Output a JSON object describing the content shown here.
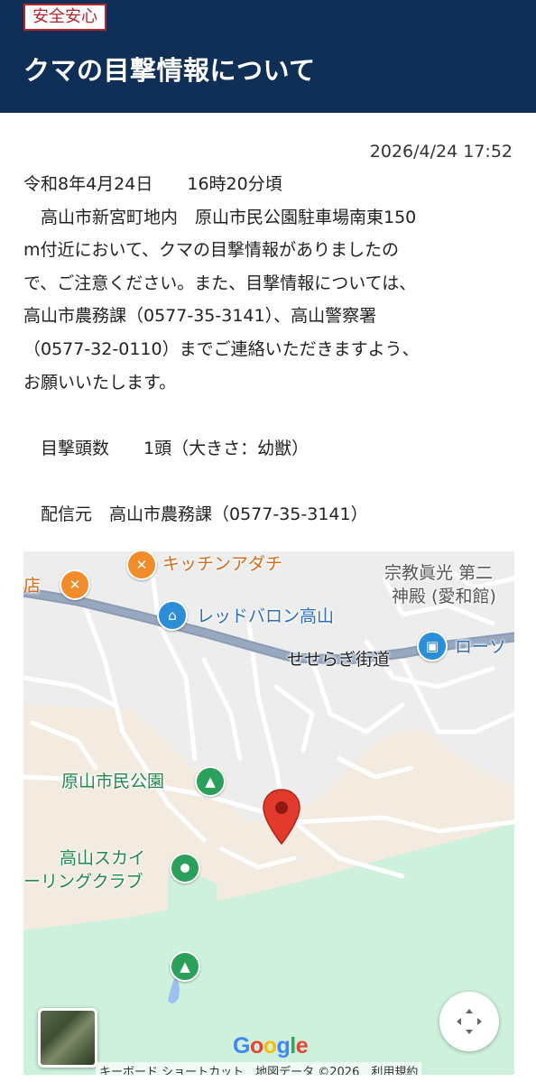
{
  "header": {
    "category": "安全安心",
    "title": "クマの目撃情報について"
  },
  "article": {
    "timestamp": "2026/4/24 17:52",
    "lines": [
      "令和8年4月24日　　16時20分頃",
      "　高山市新宮町地内　原山市民公園駐車場南東150",
      "m付近において、クマの目撃情報がありましたの",
      "で、ご注意ください。また、目撃情報については、",
      "高山市農務課（0577-35-3141）、高山警察署",
      "（0577-32-0110）までご連絡いただきますよう、",
      "お願いいたします。",
      "",
      "　目撃頭数　　1頭（大きさ：幼獣）",
      "",
      "　配信元　高山市農務課（0577-35-3141）"
    ]
  },
  "map": {
    "labels": {
      "kitchen": "キッチンアダチ",
      "store_partial": "店",
      "red_baron": "レッドバロン高山",
      "religion_1": "宗教眞光 第二",
      "religion_2": "神殿 (愛和館)",
      "seseragi": "せせらぎ街道",
      "lawson": "ローソ",
      "park": "原山市民公園",
      "sky_1": "高山スカイ",
      "sky_2": "ーリングクラブ"
    },
    "logo": "Google",
    "attribution": "キーボード ショートカット　地図データ ©2026　利用規約",
    "icons": {
      "restaurant": "restaurant-icon",
      "shopping": "shopping-bag-icon",
      "convenience": "store-icon",
      "park": "tree-icon",
      "golf": "place-dot-icon",
      "pin": "map-pin-icon",
      "fullscreen": "fullscreen-icon"
    },
    "colors": {
      "road": "#8a9bb3",
      "park_area": "#cdf1dc",
      "sand_area": "#f3ebdf",
      "pin": "#e23b2e"
    }
  }
}
